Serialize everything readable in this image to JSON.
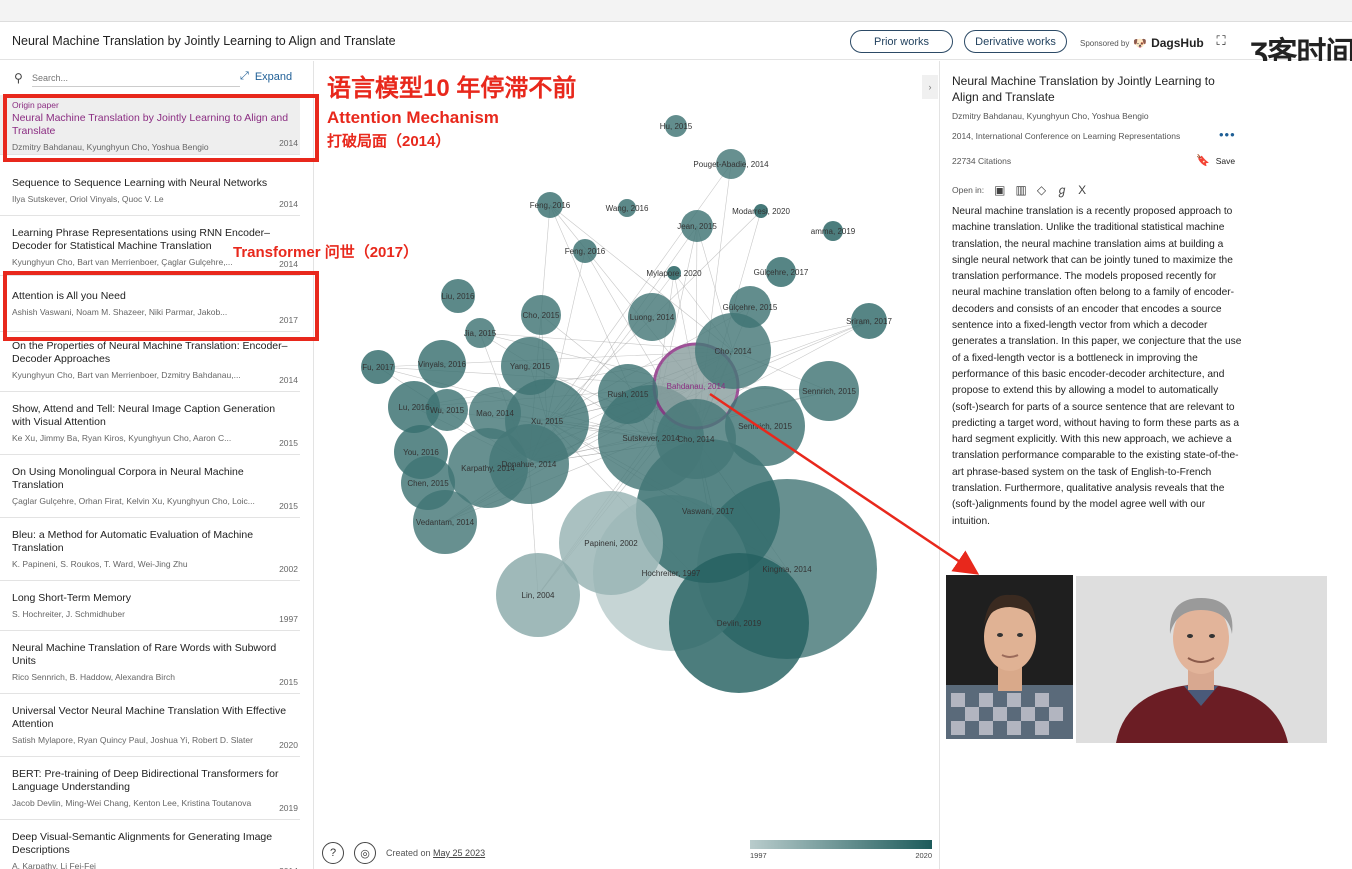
{
  "header": {
    "title": "Neural Machine Translation by Jointly Learning to Align and Translate",
    "prior_works": "Prior works",
    "derivative_works": "Derivative works",
    "sponsored_by": "Sponsored by",
    "sponsor_name": "DagsHub",
    "watermark": "Ʒ客时间"
  },
  "search": {
    "placeholder": "Search...",
    "expand": "Expand"
  },
  "papers": [
    {
      "label": "Origin paper",
      "title": "Neural Machine Translation by Jointly Learning to Align and Translate",
      "authors": "Dzmitry Bahdanau, Kyunghyun Cho, Yoshua Bengio",
      "year": "2014"
    },
    {
      "title": "Sequence to Sequence Learning with Neural Networks",
      "authors": "Ilya Sutskever, Oriol Vinyals, Quoc V. Le",
      "year": "2014"
    },
    {
      "title": "Learning Phrase Representations using RNN Encoder–Decoder for Statistical Machine Translation",
      "authors": "Kyunghyun Cho, Bart van Merrienboer, Çaglar Gulçehre,...",
      "year": "2014"
    },
    {
      "title": "Attention is All you Need",
      "authors": "Ashish Vaswani, Noam M. Shazeer, Niki Parmar, Jakob...",
      "year": "2017"
    },
    {
      "title": "On the Properties of Neural Machine Translation: Encoder–Decoder Approaches",
      "authors": "Kyunghyun Cho, Bart van Merrienboer, Dzmitry Bahdanau,...",
      "year": "2014"
    },
    {
      "title": "Show, Attend and Tell: Neural Image Caption Generation with Visual Attention",
      "authors": "Ke Xu, Jimmy Ba, Ryan Kiros, Kyunghyun Cho, Aaron C...",
      "year": "2015"
    },
    {
      "title": "On Using Monolingual Corpora in Neural Machine Translation",
      "authors": "Çaglar Gulçehre, Orhan Firat, Kelvin Xu, Kyunghyun Cho, Loic...",
      "year": "2015"
    },
    {
      "title": "Bleu: a Method for Automatic Evaluation of Machine Translation",
      "authors": "K. Papineni, S. Roukos, T. Ward, Wei-Jing Zhu",
      "year": "2002"
    },
    {
      "title": "Long Short-Term Memory",
      "authors": "S. Hochreiter, J. Schmidhuber",
      "year": "1997"
    },
    {
      "title": "Neural Machine Translation of Rare Words with Subword Units",
      "authors": "Rico Sennrich, B. Haddow, Alexandra Birch",
      "year": "2015"
    },
    {
      "title": "Universal Vector Neural Machine Translation With Effective Attention",
      "authors": "Satish Mylapore, Ryan Quincy Paul, Joshua Yi, Robert D. Slater",
      "year": "2020"
    },
    {
      "title": "BERT: Pre-training of Deep Bidirectional Transformers for Language Understanding",
      "authors": "Jacob Devlin, Ming-Wei Chang, Kenton Lee, Kristina Toutanova",
      "year": "2019"
    },
    {
      "title": "Deep Visual-Semantic Alignments for Generating Image Descriptions",
      "authors": "A. Karpathy, Li Fei-Fei",
      "year": "2014"
    }
  ],
  "graph": {
    "nodes": [
      {
        "label": "Hu, 2015",
        "year": 2015
      },
      {
        "label": "Pouget-Abadie, 2014",
        "year": 2014
      },
      {
        "label": "Feng, 2016",
        "year": 2016
      },
      {
        "label": "Wang, 2016",
        "year": 2016
      },
      {
        "label": "Modarresi, 2020",
        "year": 2020
      },
      {
        "label": "Jean, 2015",
        "year": 2015
      },
      {
        "label": "amma, 2019",
        "year": 2019
      },
      {
        "label": "Feng, 2016",
        "year": 2016
      },
      {
        "label": "Mylapore, 2020",
        "year": 2020
      },
      {
        "label": "Gülçehre, 2017",
        "year": 2017
      },
      {
        "label": "Gülçehre, 2015",
        "year": 2015
      },
      {
        "label": "Sriram, 2017",
        "year": 2017
      },
      {
        "label": "Liu, 2016",
        "year": 2016
      },
      {
        "label": "Cho, 2015",
        "year": 2015
      },
      {
        "label": "Jia, 2015",
        "year": 2015
      },
      {
        "label": "Luong, 2014",
        "year": 2014
      },
      {
        "label": "Cho, 2014",
        "year": 2014
      },
      {
        "label": "Fu, 2017",
        "year": 2017
      },
      {
        "label": "Vinyals, 2016",
        "year": 2016
      },
      {
        "label": "Yang, 2015",
        "year": 2015
      },
      {
        "label": "Sennrich, 2015",
        "year": 2015
      },
      {
        "label": "Rush, 2015",
        "year": 2015
      },
      {
        "label": "Bahdanau, 2014",
        "year": 2014
      },
      {
        "label": "Lu, 2016",
        "year": 2016
      },
      {
        "label": "Wu, 2015",
        "year": 2015
      },
      {
        "label": "Mao, 2014",
        "year": 2014
      },
      {
        "label": "Xu, 2015",
        "year": 2015
      },
      {
        "label": "Sennrich, 2015",
        "year": 2015
      },
      {
        "label": "Sutskever, 2014",
        "year": 2014
      },
      {
        "label": "Cho, 2014",
        "year": 2014
      },
      {
        "label": "You, 2016",
        "year": 2016
      },
      {
        "label": "Donahue, 2014",
        "year": 2014
      },
      {
        "label": "Karpathy, 2014",
        "year": 2014
      },
      {
        "label": "Chen, 2015",
        "year": 2015
      },
      {
        "label": "Vaswani, 2017",
        "year": 2017
      },
      {
        "label": "Vedantam, 2014",
        "year": 2014
      },
      {
        "label": "Papineni, 2002",
        "year": 2002
      },
      {
        "label": "Kingma, 2014",
        "year": 2014
      },
      {
        "label": "Lin, 2004",
        "year": 2004
      },
      {
        "label": "Hochreiter, 1997",
        "year": 1997
      },
      {
        "label": "Devlin, 2019",
        "year": 2019
      }
    ],
    "created_prefix": "Created on",
    "created_date": "May 25 2023",
    "legend_min": "1997",
    "legend_max": "2020"
  },
  "detail": {
    "title": "Neural Machine Translation by Jointly Learning to Align and Translate",
    "authors": "Dzmitry Bahdanau, Kyunghyun Cho, Yoshua Bengio",
    "venue": "2014, International Conference on Learning Representations",
    "citations": "22734 Citations",
    "save": "Save",
    "open_in": "Open in:",
    "abstract": "Neural machine translation is a recently proposed approach to machine translation. Unlike the traditional statistical machine translation, the neural machine translation aims at building a single neural network that can be jointly tuned to maximize the translation performance. The models proposed recently for neural machine translation often belong to a family of encoder-decoders and consists of an encoder that encodes a source sentence into a fixed-length vector from which a decoder generates a translation. In this paper, we conjecture that the use of a fixed-length vector is a bottleneck in improving the performance of this basic encoder-decoder architecture, and propose to extend this by allowing a model to automatically (soft-)search for parts of a source sentence that are relevant to predicting a target word, without having to form these parts as a hard segment explicitly. With this new approach, we achieve a translation performance comparable to the existing state-of-the-art phrase-based system on the task of English-to-French translation. Furthermore, qualitative analysis reveals that the (soft-)alignments found by the model agree well with our intuition."
  },
  "annotations": {
    "headline": "语言模型10 年停滞不前",
    "attention_title": "Attention Mechanism",
    "attention_sub": "打破局面（2014）",
    "transformer": "Transformer 问世（2017）"
  },
  "colors": {
    "accent": "#e8281c",
    "origin_purple": "#8b2d82",
    "node_dark": "#1d5b5b",
    "node_light": "#b9cccc"
  }
}
